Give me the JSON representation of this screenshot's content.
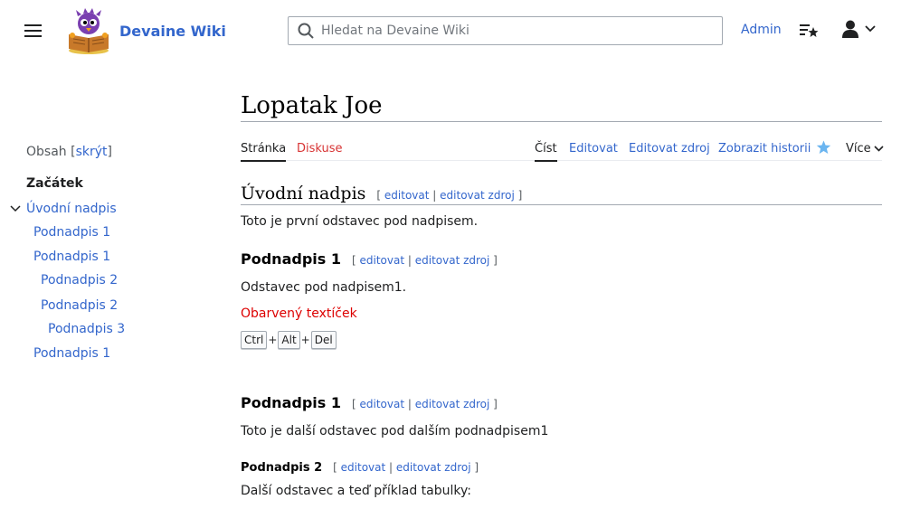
{
  "header": {
    "site_name": "Devaine Wiki",
    "search_placeholder": "Hledat na Devaine Wiki",
    "admin_link": "Admin"
  },
  "toc": {
    "title": "Obsah",
    "toggle_label": "skrýt",
    "start": "Začátek",
    "items": [
      {
        "label": "Úvodní nadpis",
        "level": 1
      },
      {
        "label": "Podnadpis 1",
        "level": 2
      },
      {
        "label": "Podnadpis 1",
        "level": 2
      },
      {
        "label": "Podnadpis 2",
        "level": 3
      },
      {
        "label": "Podnadpis 2",
        "level": 3
      },
      {
        "label": "Podnadpis 3",
        "level": 4
      },
      {
        "label": "Podnadpis 1",
        "level": 2
      }
    ]
  },
  "page": {
    "title": "Lopatak Joe",
    "tabs": {
      "page": "Stránka",
      "talk": "Diskuse",
      "read": "Číst",
      "edit": "Editovat",
      "edit_source": "Editovat zdroj",
      "history": "Zobrazit historii",
      "more": "Více"
    }
  },
  "content": {
    "edit_labels": {
      "edit": "editovat",
      "edit_source": "editovat zdroj"
    },
    "h2": "Úvodní nadpis",
    "p1": "Toto je první odstavec pod nadpisem.",
    "h3a": "Podnadpis 1",
    "p2": "Odstavec pod nadpisem1.",
    "colored_text": "Obarvený textíček",
    "keys": [
      "Ctrl",
      "Alt",
      "Del"
    ],
    "h3b": "Podnadpis 1",
    "p3": "Toto je další odstavec pod dalším podnadpisem1",
    "h4": "Podnadpis 2",
    "p4": "Další odstavec a teď příklad tabulky:"
  },
  "colors": {
    "link": "#3366cc",
    "red_link": "#d73333",
    "colored_text": "#dd0000"
  }
}
